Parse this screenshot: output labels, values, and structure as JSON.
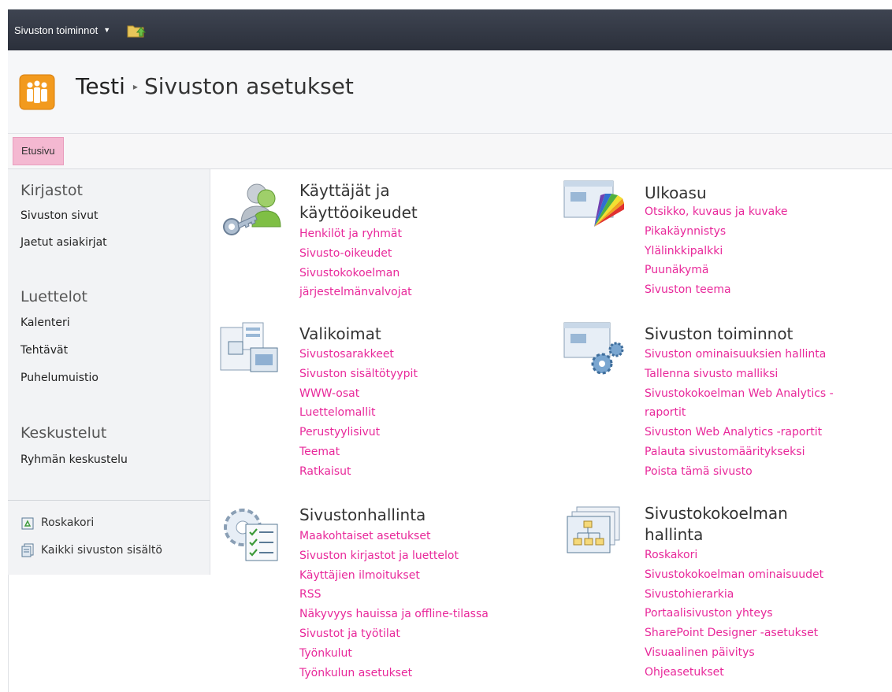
{
  "ribbon": {
    "site_actions_label": "Sivuston toiminnot"
  },
  "header": {
    "site_name": "Testi",
    "page_title": "Sivuston asetukset"
  },
  "topnav": {
    "home_tab": "Etusivu"
  },
  "leftnav": {
    "libraries_heading": "Kirjastot",
    "libraries": [
      "Sivuston sivut",
      "Jaetut asiakirjat"
    ],
    "lists_heading": "Luettelot",
    "lists": [
      "Kalenteri",
      "Tehtävät",
      "Puhelumuistio"
    ],
    "discussions_heading": "Keskustelut",
    "discussions": [
      "Ryhmän keskustelu"
    ],
    "recycle_bin": "Roskakori",
    "all_content": "Kaikki sivuston sisältö"
  },
  "sections": {
    "users": {
      "title_line1": "Käyttäjät ja",
      "title_line2": "käyttöoikeudet",
      "links": [
        "Henkilöt ja ryhmät",
        "Sivusto-oikeudet",
        "Sivustokokoelman",
        "järjestelmänvalvojat"
      ]
    },
    "look": {
      "title": "Ulkoasu",
      "links": [
        "Otsikko, kuvaus ja kuvake",
        "Pikakäynnistys",
        "Ylälinkkipalkki",
        "Puunäkymä",
        "Sivuston teema"
      ]
    },
    "galleries": {
      "title": "Valikoimat",
      "links": [
        "Sivustosarakkeet",
        "Sivuston sisältötyypit",
        "WWW-osat",
        "Luettelomallit",
        "Perustyylisivut",
        "Teemat",
        "Ratkaisut"
      ]
    },
    "site_actions": {
      "title": "Sivuston toiminnot",
      "links": [
        "Sivuston ominaisuuksien hallinta",
        "Tallenna sivusto malliksi",
        "Sivustokokoelman Web Analytics -",
        "raportit",
        "Sivuston Web Analytics -raportit",
        "Palauta sivustomääritykseksi",
        "Poista tämä sivusto"
      ]
    },
    "site_admin": {
      "title": "Sivustonhallinta",
      "links": [
        "Maakohtaiset asetukset",
        "Sivuston kirjastot ja luettelot",
        "Käyttäjien ilmoitukset",
        "RSS",
        "Näkyvyys hauissa ja offline-tilassa",
        "Sivustot ja työtilat",
        "Työnkulut",
        "Työnkulun asetukset"
      ]
    },
    "collection_admin": {
      "title_line1": "Sivustokokoelman",
      "title_line2": "hallinta",
      "links": [
        "Roskakori",
        "Sivustokokoelman ominaisuudet",
        "Sivustohierarkia",
        "Portaalisivuston yhteys",
        "SharePoint Designer -asetukset",
        "Visuaalinen päivitys",
        "Ohjeasetukset"
      ]
    }
  }
}
